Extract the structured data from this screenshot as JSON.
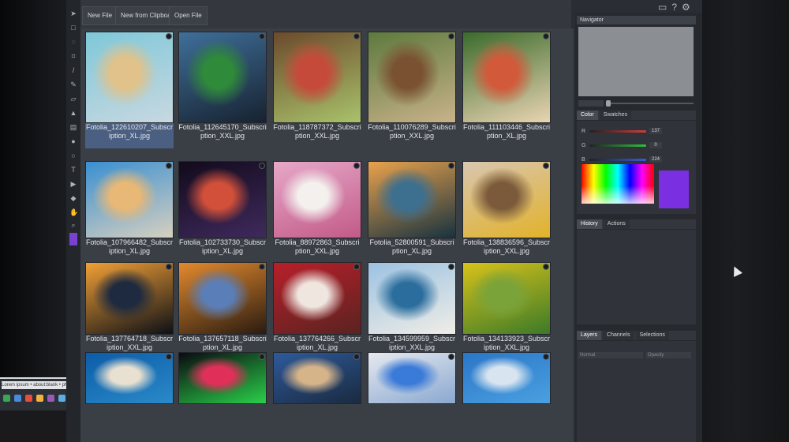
{
  "taskbar": {
    "strip_text": "Lorem ipsum • about:blank • photo",
    "app_colors": [
      "#3aa757",
      "#4a89dc",
      "#e74c3c",
      "#f5b041",
      "#9b59b6",
      "#5dade2"
    ]
  },
  "top": {
    "buttons": [
      "New File",
      "New from Clipboard",
      "Open File"
    ]
  },
  "grid_thumbs": [
    {
      "caption": "Fotolia_122610207_Subscription_XL.jpg",
      "colors": [
        "#7ec8d9",
        "#e0c28a",
        "#c8d8e0"
      ],
      "selected": true
    },
    {
      "caption": "Fotolia_112645170_Subscription_XXL.jpg",
      "colors": [
        "#3f6f9a",
        "#2f8a3a",
        "#172230"
      ],
      "selected": false
    },
    {
      "caption": "Fotolia_118787372_Subscription_XXL.jpg",
      "colors": [
        "#6b4a2b",
        "#c64a3a",
        "#a9c26b"
      ],
      "selected": false
    },
    {
      "caption": "Fotolia_110076289_Subscription_XXL.jpg",
      "colors": [
        "#5d7a3d",
        "#7a5232",
        "#c9b28a"
      ],
      "selected": false
    },
    {
      "caption": "Fotolia_111103446_Subscription_XL.jpg",
      "colors": [
        "#3b6b2c",
        "#d2593a",
        "#e9d4b2"
      ],
      "selected": false
    },
    {
      "caption": "Fotolia_107966482_Subscription_XL.jpg",
      "colors": [
        "#3a8fd1",
        "#e8b876",
        "#d6d0c0"
      ],
      "selected": false
    },
    {
      "caption": "Fotolia_102733730_Subscription_XL.jpg",
      "colors": [
        "#120a1c",
        "#d2503a",
        "#3f2a5c"
      ],
      "selected": false
    },
    {
      "caption": "Fotolia_88972863_Subscription_XXL.jpg",
      "colors": [
        "#e6a8c8",
        "#f4f0ee",
        "#c25a88"
      ],
      "selected": false
    },
    {
      "caption": "Fotolia_52800591_Subscription_XL.jpg",
      "colors": [
        "#e9a24c",
        "#3d6f8f",
        "#18323f"
      ],
      "selected": false
    },
    {
      "caption": "Fotolia_138836596_Subscription_XXL.jpg",
      "colors": [
        "#d8c6b0",
        "#7a5a3a",
        "#e2b22a"
      ],
      "selected": false
    },
    {
      "caption": "Fotolia_137764718_Subscription_XXL.jpg",
      "colors": [
        "#f2a036",
        "#1d2a3f",
        "#0d1016"
      ],
      "selected": false
    },
    {
      "caption": "Fotolia_137657118_Subscription_XL.jpg",
      "colors": [
        "#e38a2e",
        "#5a7fb8",
        "#2a1b10"
      ],
      "selected": false
    },
    {
      "caption": "Fotolia_137764266_Subscription_XL.jpg",
      "colors": [
        "#b81f2a",
        "#f0e6e0",
        "#5a2320"
      ],
      "selected": false
    },
    {
      "caption": "Fotolia_134599959_Subscription_XXL.jpg",
      "colors": [
        "#9cc2e2",
        "#2b6e9e",
        "#f0ede6"
      ],
      "selected": false
    },
    {
      "caption": "Fotolia_134133923_Subscription_XXL.jpg",
      "colors": [
        "#d7c21a",
        "#7aa33a",
        "#3c7a28"
      ],
      "selected": false
    },
    {
      "caption": "",
      "colors": [
        "#0c5ca8",
        "#e8e0d0",
        "#2a8ac8"
      ],
      "selected": false
    },
    {
      "caption": "",
      "colors": [
        "#0a0a10",
        "#e0305a",
        "#2ad04a"
      ],
      "selected": false
    },
    {
      "caption": "",
      "colors": [
        "#2e5a9a",
        "#d6b48a",
        "#1a2a40"
      ],
      "selected": false
    },
    {
      "caption": "",
      "colors": [
        "#e6e9ef",
        "#3a7ad8",
        "#8aa8d0"
      ],
      "selected": false
    },
    {
      "caption": "",
      "colors": [
        "#2a76c8",
        "#d8e4f0",
        "#4aa0e0"
      ],
      "selected": false
    }
  ],
  "panels": {
    "navigator_title": "Navigator",
    "color_tabs": [
      "Color",
      "Swatches"
    ],
    "channels": [
      {
        "label": "R",
        "value": "137",
        "bar": "#d23a3a"
      },
      {
        "label": "G",
        "value": "0",
        "bar": "#2fbf3a"
      },
      {
        "label": "B",
        "value": "224",
        "bar": "#3a5ad8"
      }
    ],
    "current_color": "#7a2fe0",
    "history_tabs": [
      "History",
      "Actions"
    ],
    "layer_tabs": [
      "Layers",
      "Channels",
      "Selections"
    ],
    "blend_mode": "Normal",
    "opacity_label": "Opacity"
  }
}
